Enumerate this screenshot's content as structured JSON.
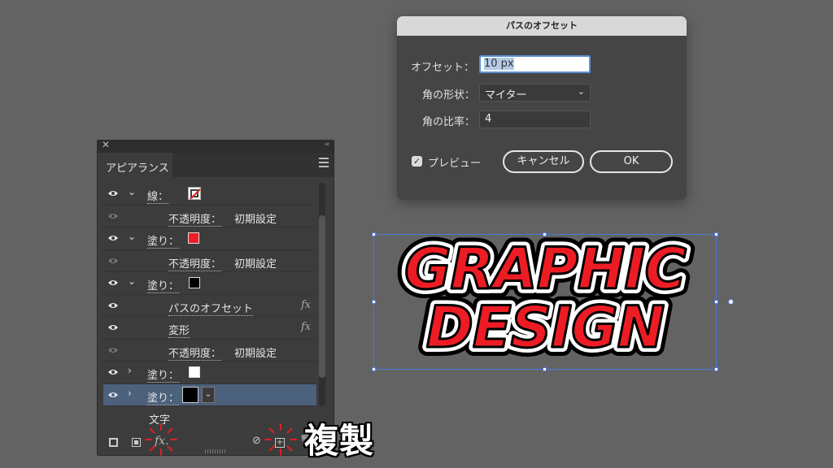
{
  "panel": {
    "tab": "アピアランス",
    "rows": [
      {
        "label": "線：",
        "kind": "stroke"
      },
      {
        "sub": "不透明度：",
        "value": "初期設定"
      },
      {
        "label": "塗り：",
        "kind": "fill-red"
      },
      {
        "sub": "不透明度：",
        "value": "初期設定"
      },
      {
        "label": "塗り：",
        "kind": "fill-black"
      },
      {
        "sub": "パスのオフセット",
        "fx": "fx"
      },
      {
        "sub": "変形",
        "fx": "fx"
      },
      {
        "sub": "不透明度：",
        "value": "初期設定"
      },
      {
        "label": "塗り：",
        "kind": "fill-white"
      },
      {
        "label": "塗り：",
        "kind": "fill-black-selected"
      }
    ],
    "text_row": "文字",
    "footer_fx": "fx."
  },
  "annotation": "複製",
  "dialog": {
    "title": "パスのオフセット",
    "offset_label": "オフセット：",
    "offset_value": "10 px",
    "joins_label": "角の形状：",
    "joins_value": "マイター",
    "miter_label": "角の比率：",
    "miter_value": "4",
    "preview_label": "プレビュー",
    "cancel_label": "キャンセル",
    "ok_label": "OK"
  },
  "artwork": {
    "line1": "GRAPHIC",
    "line2": "DESIGN",
    "colors": {
      "fill": "#ed1c24",
      "outline": "#000000",
      "offset": "#ffffff"
    }
  }
}
